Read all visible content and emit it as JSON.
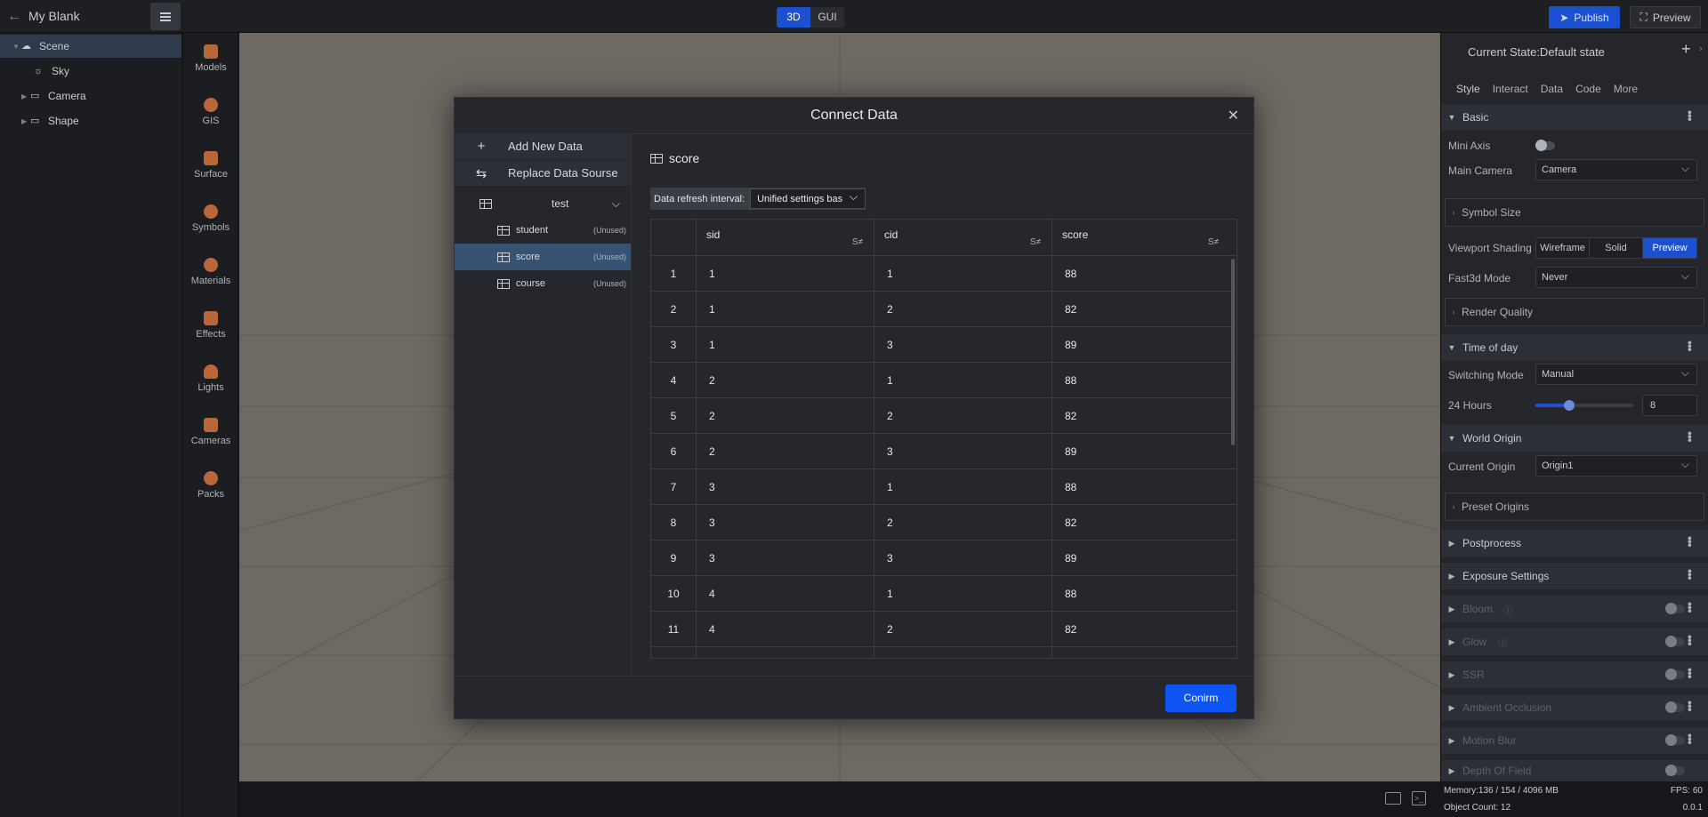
{
  "app": {
    "title": "My Blank",
    "mode_tabs": [
      "3D",
      "GUI"
    ],
    "active_mode": "3D",
    "publish_label": "Publish",
    "preview_label": "Preview"
  },
  "scene_tree": [
    {
      "label": "Scene",
      "icon": "scene-icon",
      "selected": true
    },
    {
      "label": "Sky",
      "icon": "sky-icon"
    },
    {
      "label": "Camera",
      "icon": "folder-icon"
    },
    {
      "label": "Shape",
      "icon": "folder-icon"
    }
  ],
  "assets": [
    "Models",
    "GIS",
    "Surface",
    "Symbols",
    "Materials",
    "Effects",
    "Lights",
    "Cameras",
    "Packs"
  ],
  "right_panel": {
    "state": "Current State:Default state",
    "tabs": [
      "Style",
      "Interact",
      "Data",
      "Code",
      "More"
    ],
    "active_tab": "Style",
    "basic": "Basic",
    "mini_axis": "Mini Axis",
    "main_camera_label": "Main Camera",
    "main_camera_value": "Camera",
    "symbol_size": "Symbol Size",
    "viewport_shading_label": "Viewport Shading",
    "shading_options": [
      "Wireframe",
      "Solid",
      "Preview"
    ],
    "fast3d_label": "Fast3d Mode",
    "fast3d_value": "Never",
    "render_quality": "Render Quality",
    "time_of_day": "Time of day",
    "switching_label": "Switching Mode",
    "switching_value": "Manual",
    "hours_label": "24 Hours",
    "hours_value": "8",
    "world_origin": "World Origin",
    "current_origin_label": "Current Origin",
    "current_origin_value": "Origin1",
    "preset_origins": "Preset Origins",
    "postprocess": "Postprocess",
    "exposure": "Exposure Settings",
    "bloom": "Bloom",
    "glow": "Glow",
    "ssr": "SSR",
    "ao": "Ambient Occlusion",
    "motion_blur": "Motion Blur",
    "dof": "Depth Of Field"
  },
  "status": {
    "memory": "Memory:136 / 154 / 4096 MB",
    "fps": "FPS: 60",
    "objects": "Object Count: 12",
    "version": "0.0.1"
  },
  "modal": {
    "title": "Connect Data",
    "add_new": "Add New Data",
    "replace": "Replace Data Sourse",
    "source_name": "test",
    "tables": [
      {
        "name": "student",
        "status": "(Unused)"
      },
      {
        "name": "score",
        "status": "(Unused)",
        "selected": true
      },
      {
        "name": "course",
        "status": "(Unused)"
      }
    ],
    "table_title": "score",
    "refresh_label": "Data refresh interval:",
    "refresh_value": "Unified settings bas",
    "columns": [
      "sid",
      "cid",
      "score"
    ],
    "rows": [
      [
        "1",
        "1",
        "1",
        "88"
      ],
      [
        "2",
        "1",
        "2",
        "82"
      ],
      [
        "3",
        "1",
        "3",
        "89"
      ],
      [
        "4",
        "2",
        "1",
        "88"
      ],
      [
        "5",
        "2",
        "2",
        "82"
      ],
      [
        "6",
        "2",
        "3",
        "89"
      ],
      [
        "7",
        "3",
        "1",
        "88"
      ],
      [
        "8",
        "3",
        "2",
        "82"
      ],
      [
        "9",
        "3",
        "3",
        "89"
      ],
      [
        "10",
        "4",
        "1",
        "88"
      ],
      [
        "11",
        "4",
        "2",
        "82"
      ]
    ],
    "confirm": "Conirm"
  }
}
